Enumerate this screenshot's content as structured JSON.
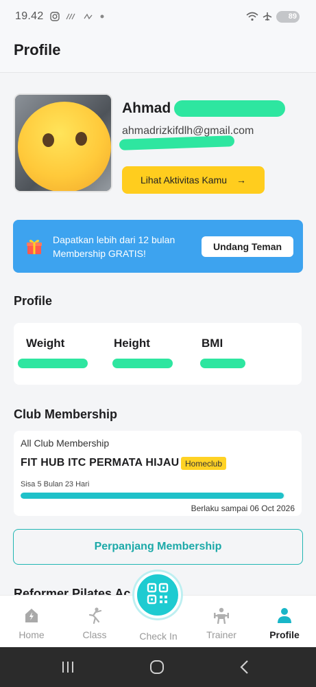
{
  "status_bar": {
    "time": "19.42",
    "battery": "89"
  },
  "header": {
    "title": "Profile"
  },
  "user": {
    "name": "Ahmad",
    "email": "ahmadrizkifdlh@gmail.com",
    "activity_button": "Lihat Aktivitas Kamu",
    "activity_arrow": "→"
  },
  "promo": {
    "text": "Dapatkan lebih dari 12 bulan Membership GRATIS!",
    "button": "Undang Teman"
  },
  "profile_section": {
    "title": "Profile",
    "stats": [
      {
        "label": "Weight"
      },
      {
        "label": "Height"
      },
      {
        "label": "BMI"
      }
    ]
  },
  "membership_section": {
    "title": "Club Membership",
    "type": "All Club Membership",
    "club": "FIT HUB ITC PERMATA HIJAU",
    "badge": "Homeclub",
    "remaining": "Sisa 5 Bulan 23 Hari",
    "progress_fraction": 0.995,
    "valid_until": "Berlaku sampai 06 Oct 2026",
    "renew_button": "Perpanjang Membership"
  },
  "next_section_title": "Reformer Pilates Ac",
  "bottom_nav": {
    "items": [
      {
        "label": "Home",
        "icon": "home-icon"
      },
      {
        "label": "Class",
        "icon": "class-icon"
      },
      {
        "label": "Check In",
        "icon": "qr-code-icon"
      },
      {
        "label": "Trainer",
        "icon": "trainer-icon"
      },
      {
        "label": "Profile",
        "icon": "person-icon"
      }
    ],
    "active": "Profile"
  },
  "colors": {
    "accent_teal": "#1fc1c9",
    "promo_blue": "#3da3ef",
    "button_yellow": "#ffcd1e",
    "redaction_green": "#2ee6a0"
  }
}
